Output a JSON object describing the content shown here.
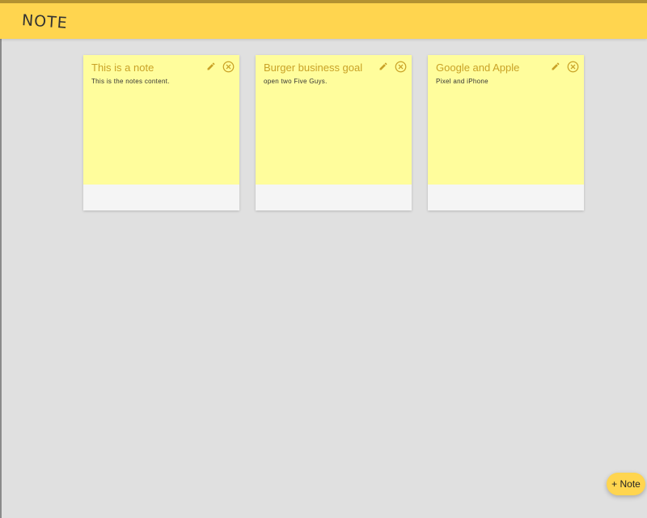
{
  "header": {
    "title": "NOTE"
  },
  "notes": [
    {
      "title": "This is a note",
      "content": "This is the notes content."
    },
    {
      "title": "Burger business goal",
      "content": "open two Five Guys."
    },
    {
      "title": "Google and Apple",
      "content": "Pixel and iPhone"
    }
  ],
  "actions": {
    "add_note_label": "+ Note",
    "edit_icon": "pencil-icon",
    "delete_icon": "close-circle-icon"
  },
  "colors": {
    "header_bg": "#ffd54f",
    "note_bg": "#fffd9c",
    "note_title": "#c9a227",
    "background": "#e0e0e0"
  }
}
